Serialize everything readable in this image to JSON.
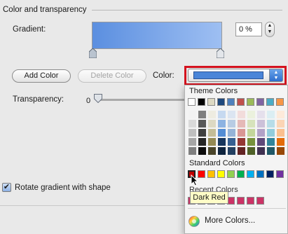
{
  "section": {
    "title": "Color and transparency"
  },
  "gradient": {
    "label": "Gradient:",
    "percent_value": "0 %"
  },
  "buttons": {
    "add_color": "Add Color",
    "delete_color": "Delete Color",
    "cancel": ""
  },
  "color": {
    "label": "Color:",
    "selected_color": "#4a85d8"
  },
  "transparency": {
    "label": "Transparency:",
    "min_value": "0"
  },
  "rotate": {
    "label": "Rotate gradient with shape",
    "checked": true
  },
  "dropdown": {
    "theme_title": "Theme Colors",
    "standard_title": "Standard Colors",
    "recent_title": "Recent Colors",
    "more_label": "More Colors...",
    "theme_colors": [
      "#ffffff",
      "#000000",
      "#ddd9c3",
      "#1f497d",
      "#4f81bd",
      "#c0504d",
      "#9bbb59",
      "#8064a2",
      "#4bacc6",
      "#f79646"
    ],
    "shade_columns": [
      [
        "#f2f2f2",
        "#d9d9d9",
        "#bfbfbf",
        "#a6a6a6",
        "#808080"
      ],
      [
        "#7f7f7f",
        "#595959",
        "#404040",
        "#262626",
        "#0d0d0d"
      ],
      [
        "#eeece1",
        "#ddd9c3",
        "#c4bd97",
        "#948a54",
        "#4a452a"
      ],
      [
        "#c6d9f0",
        "#8db3e2",
        "#548dd4",
        "#17365d",
        "#0f243e"
      ],
      [
        "#dbe5f1",
        "#b8cce4",
        "#95b3d7",
        "#366092",
        "#244061"
      ],
      [
        "#f2dcdb",
        "#e5b9b7",
        "#d99694",
        "#953734",
        "#632423"
      ],
      [
        "#ebf1dd",
        "#d7e3bc",
        "#c3d69b",
        "#76923c",
        "#4f6128"
      ],
      [
        "#e5e0ec",
        "#ccc1d9",
        "#b2a2c7",
        "#5f497a",
        "#3f3151"
      ],
      [
        "#dbeef3",
        "#b7dde8",
        "#92cddc",
        "#31859b",
        "#205867"
      ],
      [
        "#fdeada",
        "#fbd5b5",
        "#fac08f",
        "#e36c09",
        "#974806"
      ]
    ],
    "standard_colors": [
      "#c00000",
      "#ff0000",
      "#ffc000",
      "#ffff00",
      "#92d050",
      "#00b050",
      "#00b0f0",
      "#0070c0",
      "#002060",
      "#7030a0"
    ],
    "recent_colors": [
      "#cc3366",
      "#cc3366",
      "#cc3366",
      "#cc3366",
      "#cc3366",
      "#cc3366",
      "#cc3366",
      "#cc3366"
    ]
  },
  "tooltip": {
    "text": "Dark Red"
  }
}
